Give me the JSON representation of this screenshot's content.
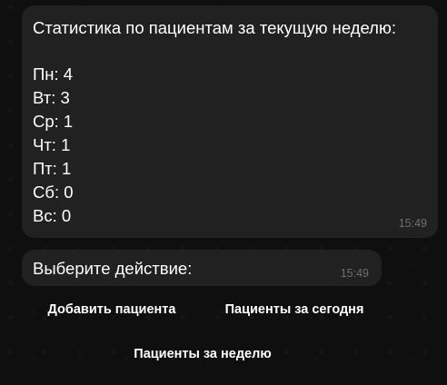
{
  "stats_message": {
    "title": "Статистика по пациентам за текущую неделю:",
    "days": [
      "Пн: 4",
      "Вт: 3",
      "Ср: 1",
      "Чт: 1",
      "Пт: 1",
      "Сб: 0",
      "Вс: 0"
    ],
    "time": "15:49"
  },
  "prompt_message": {
    "text": "Выберите действие:",
    "time": "15:49"
  },
  "keyboard": {
    "add_patient": "Добавить пациента",
    "patients_today": "Пациенты за сегодня",
    "patients_week": "Пациенты за неделю"
  },
  "colors": {
    "background": "#0f0f0f",
    "bubble": "#212121",
    "text": "#ffffff",
    "timestamp": "#6e6e6e"
  }
}
